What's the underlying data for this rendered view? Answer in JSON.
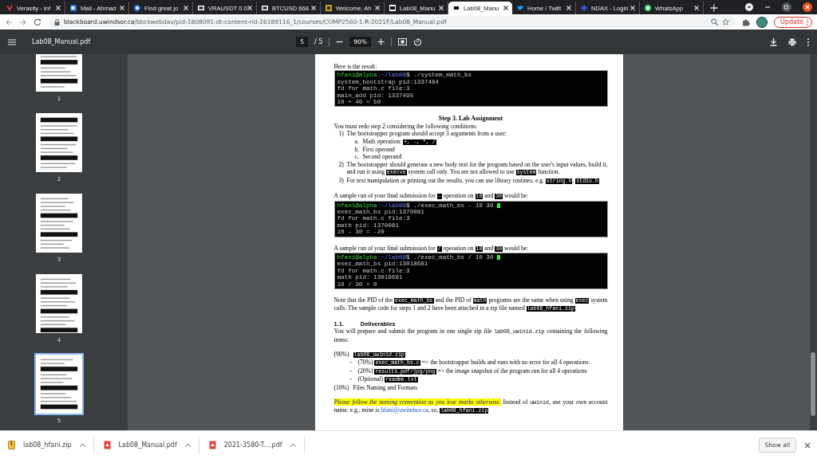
{
  "browser": {
    "tabs": [
      {
        "title": "Verasity - Inf",
        "selected": false
      },
      {
        "title": "Mail - Ahmad",
        "selected": false
      },
      {
        "title": "Find great jo",
        "selected": false
      },
      {
        "title": "VRAUSDT 0.0",
        "selected": false
      },
      {
        "title": "BTCUSD 668",
        "selected": false
      },
      {
        "title": "Welcome, Ah",
        "selected": false
      },
      {
        "title": "Lab08_Manu",
        "selected": false
      },
      {
        "title": "Lab08_Manu",
        "selected": true
      },
      {
        "title": "Home / Twitt",
        "selected": false
      },
      {
        "title": "NDAX - Login",
        "selected": false
      },
      {
        "title": "WhatsApp",
        "selected": false
      }
    ],
    "url_host": "blackboard.uwindsor.ca",
    "url_path": "/bbcswebdav/pid-1808091-dt-content-rid-26189116_1/courses/COMP2560-1-R-2021F/Lab08_Manual.pdf",
    "update_label": "Update"
  },
  "pdf_toolbar": {
    "file_name": "Lab08_Manual.pdf",
    "page_input": "5",
    "page_total": "/ 5",
    "zoom": "90%"
  },
  "thumbnails": [
    {
      "label": "1",
      "selected": false
    },
    {
      "label": "2",
      "selected": false
    },
    {
      "label": "3",
      "selected": false
    },
    {
      "label": "4",
      "selected": false
    },
    {
      "label": "5",
      "selected": true
    }
  ],
  "document": {
    "blocks": [
      {
        "kind": "para",
        "segments": [
          {
            "kind": "text",
            "t": "Here is the result:"
          }
        ]
      },
      {
        "kind": "terminal",
        "prompt_user": "hfani@alpha",
        "prompt_path": ":~/lab08",
        "command": "$ ./system_math_bs",
        "cursor": false,
        "lines": [
          "system_bootstrap pid:1337484",
          "fd for math.c file:3",
          "main_add pid: 1337495",
          "10 + 40 = 50"
        ]
      },
      {
        "kind": "heading",
        "t": "Step 3. Lab Assignment"
      },
      {
        "kind": "para",
        "segments": [
          {
            "kind": "text",
            "t": "You must redo step 2 considering the following conditions:"
          }
        ]
      },
      {
        "kind": "item",
        "marker": "1)",
        "segments": [
          {
            "kind": "text",
            "t": "The bootstrapper program should accept 3 arguments from a user:"
          }
        ],
        "children": [
          {
            "kind": "item",
            "marker": "a.",
            "segments": [
              {
                "kind": "text",
                "t": "Math operation: "
              },
              {
                "kind": "code",
                "t": "+, -, *, /"
              }
            ]
          },
          {
            "kind": "item",
            "marker": "b.",
            "segments": [
              {
                "kind": "text",
                "t": "First operand"
              }
            ]
          },
          {
            "kind": "item",
            "marker": "c.",
            "segments": [
              {
                "kind": "text",
                "t": "Second operand"
              }
            ]
          }
        ]
      },
      {
        "kind": "item",
        "marker": "2)",
        "segments": [
          {
            "kind": "text",
            "t": "The bootstrapper should generate a new body text for the program based on the user's input values, build it, and run it using "
          },
          {
            "kind": "code",
            "t": "execve"
          },
          {
            "kind": "text",
            "t": " system call only. You are not allowed to use "
          },
          {
            "kind": "code",
            "t": "system"
          },
          {
            "kind": "text",
            "t": " function."
          }
        ]
      },
      {
        "kind": "item",
        "marker": "3)",
        "segments": [
          {
            "kind": "text",
            "t": "For text manipulation or printing out the results, you can use library routines, e.g. "
          },
          {
            "kind": "code",
            "t": "string.h"
          },
          {
            "kind": "text",
            "t": ", "
          },
          {
            "kind": "code",
            "t": "stdio.h"
          }
        ]
      },
      {
        "kind": "para",
        "segments": [
          {
            "kind": "text",
            "t": "A sample run of your final submission for "
          },
          {
            "kind": "code",
            "t": "-"
          },
          {
            "kind": "text",
            "t": " operation on "
          },
          {
            "kind": "code",
            "t": "10"
          },
          {
            "kind": "text",
            "t": " and "
          },
          {
            "kind": "code",
            "t": "30"
          },
          {
            "kind": "text",
            "t": " would be:"
          }
        ]
      },
      {
        "kind": "terminal",
        "prompt_user": "hfani@alpha",
        "prompt_path": ":~/lab08",
        "command": "$ ./exec_math_bs - 10 30",
        "cursor": true,
        "lines": [
          "exec_math_bs pid:1370081",
          "fd for math.c file:3",
          "math pid: 1370081",
          "10 - 30 = -20"
        ]
      },
      {
        "kind": "para",
        "segments": [
          {
            "kind": "text",
            "t": "A sample run of your final submission for "
          },
          {
            "kind": "code",
            "t": "/"
          },
          {
            "kind": "text",
            "t": " operation on "
          },
          {
            "kind": "code",
            "t": "10"
          },
          {
            "kind": "text",
            "t": " and "
          },
          {
            "kind": "code",
            "t": "30"
          },
          {
            "kind": "text",
            "t": " would be:"
          }
        ]
      },
      {
        "kind": "terminal",
        "prompt_user": "hfani@alpha",
        "prompt_path": ":~/lab08",
        "command": "$ ./exec_math_bs / 10 30",
        "cursor": true,
        "lines": [
          "exec_math_bs pid:13018681",
          "fd for math.c file:3",
          "math pid: 13018681",
          "10 / 30 = 0"
        ]
      },
      {
        "kind": "para",
        "segments": [
          {
            "kind": "text",
            "t": "Note that the PID of the "
          },
          {
            "kind": "code",
            "t": "exec_math_bs"
          },
          {
            "kind": "text",
            "t": " and the PID of "
          },
          {
            "kind": "code",
            "t": "math"
          },
          {
            "kind": "text",
            "t": " programs are the same when using "
          },
          {
            "kind": "code",
            "t": "exec"
          },
          {
            "kind": "text",
            "t": " system calls. The sample code for steps 1 and 2 have been attached in a zip file named "
          },
          {
            "kind": "code",
            "t": "lab08_hfani.zip"
          },
          {
            "kind": "text",
            "t": "."
          }
        ]
      },
      {
        "kind": "section",
        "number": "1.1.",
        "t": "Deliverables"
      },
      {
        "kind": "para",
        "segments": [
          {
            "kind": "text",
            "t": "You will prepare and submit the program in one single zip file "
          },
          {
            "kind": "mono",
            "t": "lab08_uwinid.zip"
          },
          {
            "kind": "text",
            "t": " containing the following items:"
          }
        ]
      },
      {
        "kind": "item",
        "marker": "(90%)",
        "segments": [
          {
            "kind": "code",
            "t": "lab08_uwinid.zip"
          }
        ],
        "children": [
          {
            "kind": "item",
            "marker": "-",
            "segments": [
              {
                "kind": "text",
                "t": "(70%) "
              },
              {
                "kind": "code",
                "t": "exec_math_bs.c"
              },
              {
                "kind": "text",
                "t": " => the bootstrapper builds and runs with no error for all 4 operations."
              }
            ]
          },
          {
            "kind": "item",
            "marker": "-",
            "segments": [
              {
                "kind": "text",
                "t": "(20%) "
              },
              {
                "kind": "code",
                "t": "results.pdf/jpg/png"
              },
              {
                "kind": "text",
                "t": " =>  the image snapshot of the program run for all 4 operations"
              }
            ]
          },
          {
            "kind": "item",
            "marker": "-",
            "segments": [
              {
                "kind": "text",
                "t": "(Optional) "
              },
              {
                "kind": "code",
                "t": "readme.txt"
              }
            ]
          }
        ]
      },
      {
        "kind": "item",
        "marker": "(10%)",
        "segments": [
          {
            "kind": "text",
            "t": "Files Naming and Formats"
          }
        ]
      },
      {
        "kind": "para",
        "segments": [
          {
            "kind": "mark",
            "t": "Please follow the naming convention as you lose marks otherwise."
          },
          {
            "kind": "text",
            "t": " Instead of "
          },
          {
            "kind": "mono",
            "t": "uwinid"
          },
          {
            "kind": "text",
            "t": ", use your own account name, e.g., mine is "
          },
          {
            "kind": "link",
            "t": "hfani@uwindsor.ca"
          },
          {
            "kind": "text",
            "t": ", so, "
          },
          {
            "kind": "code",
            "t": "lab08_hfani.zip"
          }
        ]
      }
    ]
  },
  "downloads": {
    "items": [
      {
        "name": "lab08_hfani.zip",
        "kind": "zip"
      },
      {
        "name": "Lab08_Manual.pdf",
        "kind": "pdf"
      },
      {
        "name": "2021-3580-T....pdf",
        "kind": "pdf"
      }
    ],
    "show_all": "Show all"
  }
}
